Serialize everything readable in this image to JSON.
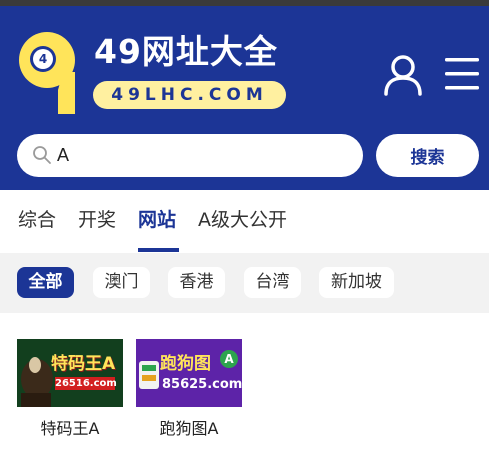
{
  "brand": {
    "logo_number": "4",
    "title": "49网址大全",
    "url": "49LHC.COM"
  },
  "header_icons": {
    "user": "user-icon",
    "menu": "hamburger-menu-icon"
  },
  "search": {
    "value": "A",
    "button_label": "搜索"
  },
  "tabs": [
    {
      "label": "综合",
      "active": false
    },
    {
      "label": "开奖",
      "active": false
    },
    {
      "label": "网站",
      "active": true
    },
    {
      "label": "A级大公开",
      "active": false
    }
  ],
  "filters": [
    {
      "label": "全部",
      "active": true
    },
    {
      "label": "澳门",
      "active": false
    },
    {
      "label": "香港",
      "active": false
    },
    {
      "label": "台湾",
      "active": false
    },
    {
      "label": "新加坡",
      "active": false
    }
  ],
  "results": [
    {
      "label": "特码王A",
      "thumb_title": "特码王A",
      "thumb_url": "26516.com"
    },
    {
      "label": "跑狗图A",
      "thumb_title": "跑狗图",
      "thumb_badge": "A",
      "thumb_url": "85625.com"
    }
  ],
  "colors": {
    "brand_blue": "#1c3596",
    "logo_yellow": "#ffe45a",
    "url_pill": "#fff0a0",
    "filter_bg": "#f2f2f2"
  }
}
